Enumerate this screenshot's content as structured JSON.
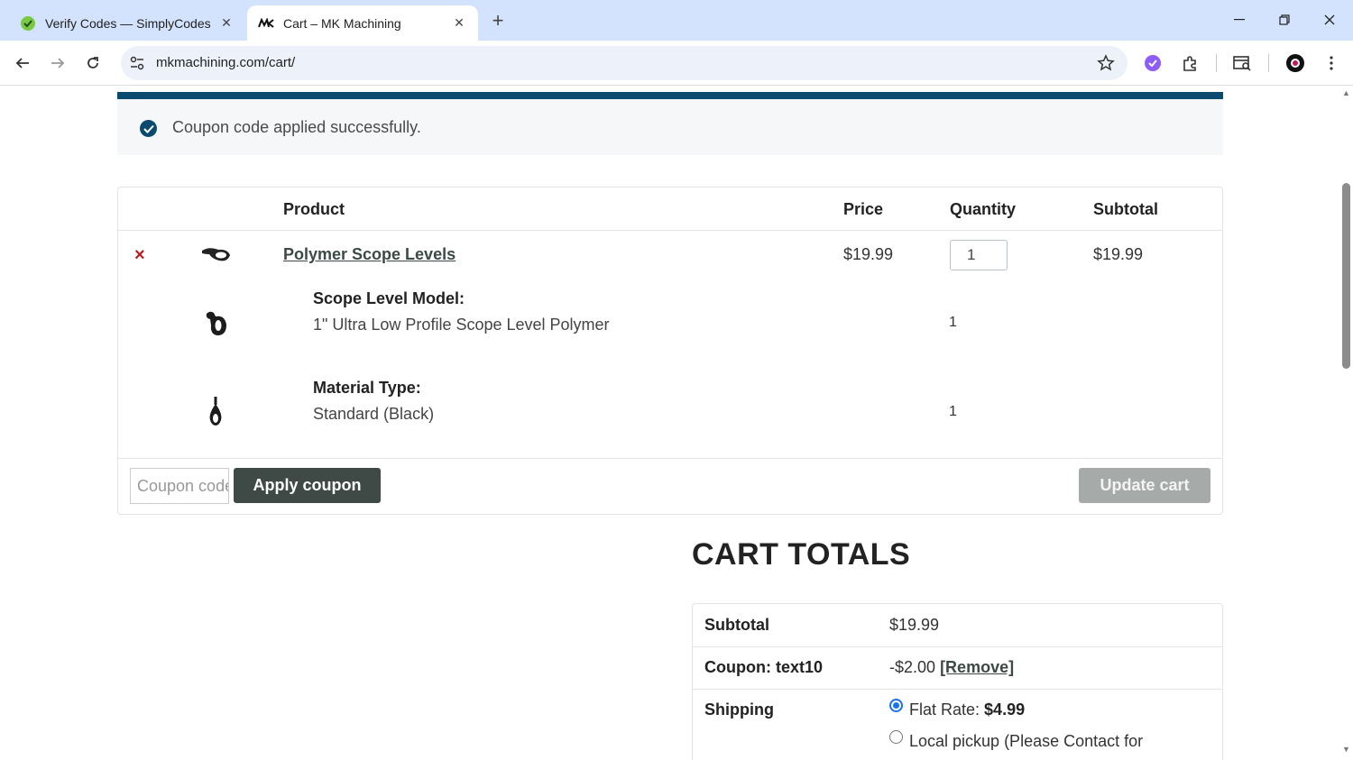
{
  "browser": {
    "tabs": [
      {
        "title": "Verify Codes — SimplyCodes",
        "active": false
      },
      {
        "title": "Cart – MK Machining",
        "active": true
      }
    ],
    "url": "mkmachining.com/cart/"
  },
  "notice": {
    "message": "Coupon code applied successfully."
  },
  "cart": {
    "headers": {
      "product": "Product",
      "price": "Price",
      "quantity": "Quantity",
      "subtotal": "Subtotal"
    },
    "item": {
      "name": "Polymer Scope Levels",
      "price": "$19.99",
      "quantity": "1",
      "subtotal": "$19.99",
      "remove_symbol": "×",
      "options": [
        {
          "label": "Scope Level Model:",
          "value": "1\" Ultra Low Profile Scope Level Polymer",
          "qty": "1"
        },
        {
          "label": "Material Type:",
          "value": "Standard (Black)",
          "qty": "1"
        }
      ]
    },
    "coupon_placeholder": "Coupon code",
    "apply_label": "Apply coupon",
    "update_label": "Update cart"
  },
  "totals": {
    "title": "CART TOTALS",
    "subtotal_label": "Subtotal",
    "subtotal_value": "$19.99",
    "coupon_label": "Coupon: text10",
    "coupon_value": "-$2.00",
    "coupon_remove": "[Remove]",
    "shipping_label": "Shipping",
    "shipping_options": [
      {
        "label": "Flat Rate:",
        "price": "$4.99",
        "selected": true
      },
      {
        "label": "Local pickup (Please Contact for",
        "price": "",
        "selected": false
      }
    ]
  },
  "colors": {
    "notice_bar": "#0b4a6f",
    "apply_button": "#3f4a46",
    "update_button": "#a6aaa8",
    "remove_x": "#b81c23"
  }
}
